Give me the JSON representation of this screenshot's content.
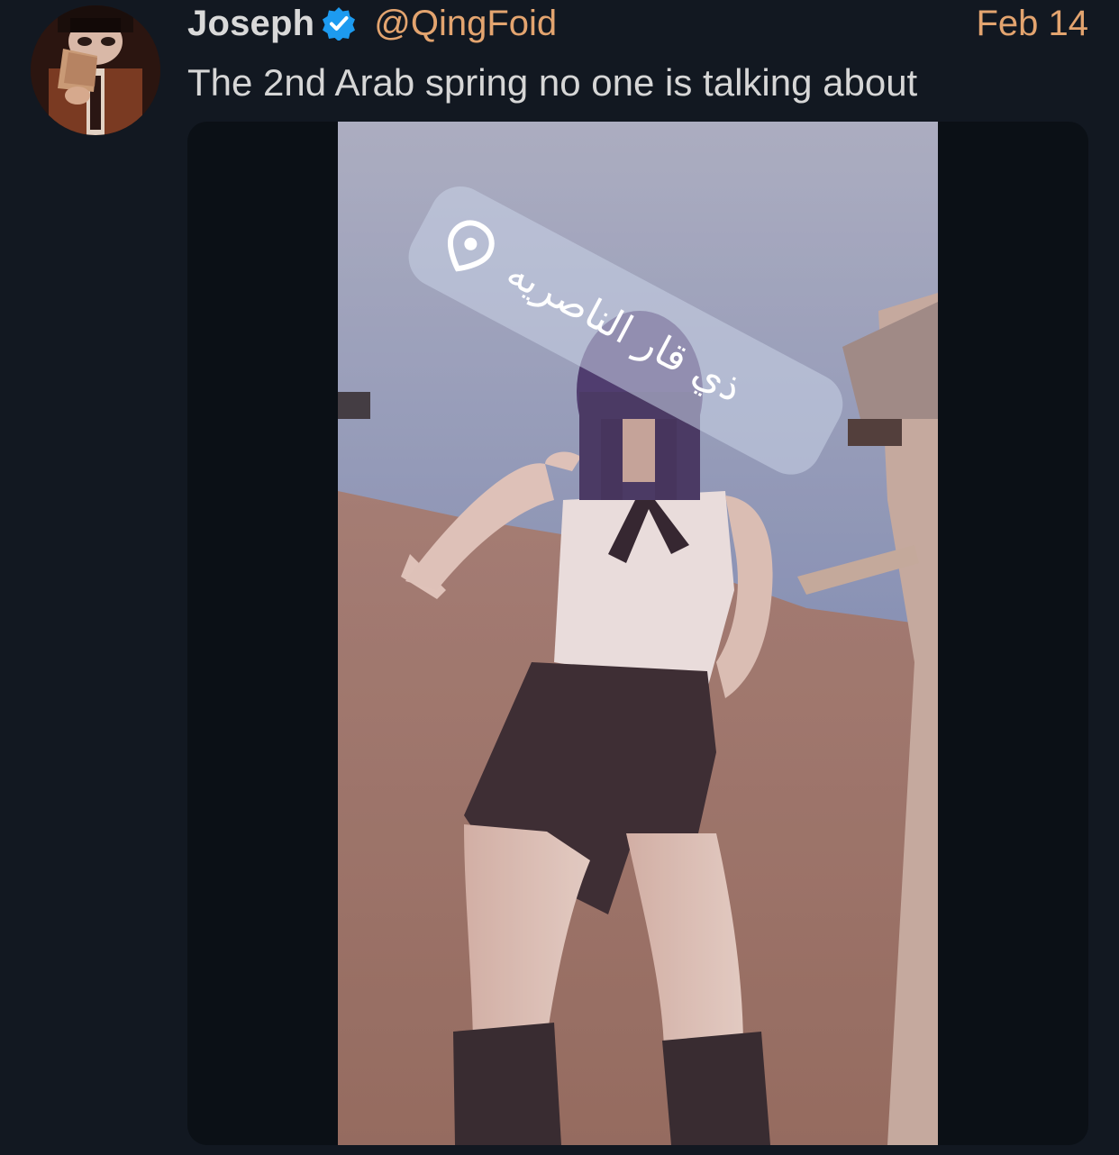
{
  "tweet": {
    "author": {
      "display_name": "Joseph",
      "handle": "@QingFoid",
      "verified": true,
      "avatar_icon": "avatar-illustration"
    },
    "date": "Feb 14",
    "text": "The 2nd Arab spring no one is talking about",
    "media": {
      "type": "photo",
      "overlay_location": "ذي قار الناصريه",
      "overlay_icon": "location-pin-icon"
    }
  },
  "colors": {
    "background": "#121821",
    "accent": "#e3a46f",
    "verified_blue": "#1d9bf0",
    "name_text": "#d9d9d9",
    "body_text": "#d6d6d6"
  }
}
